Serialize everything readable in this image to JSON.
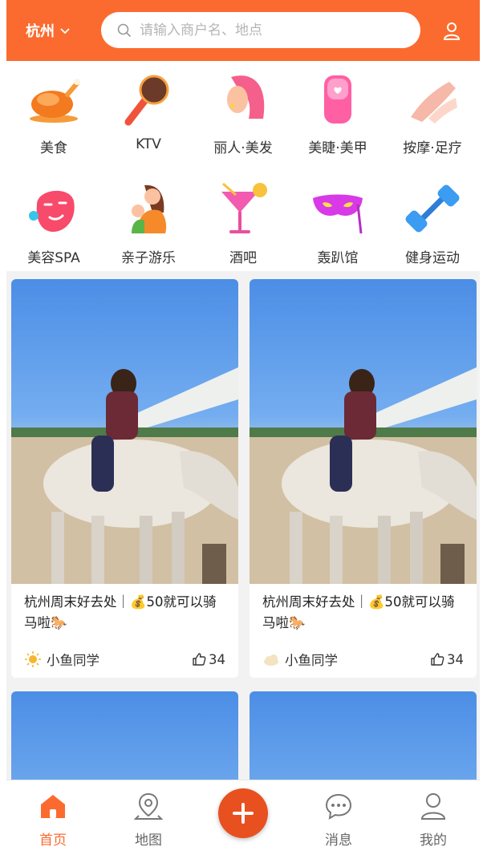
{
  "header": {
    "city": "杭州",
    "search_placeholder": "请输入商户名、地点",
    "accent": "#fb6b2f"
  },
  "categories": [
    {
      "label": "美食",
      "icon": "roast-chicken-icon"
    },
    {
      "label": "KTV",
      "icon": "microphone-icon"
    },
    {
      "label": "丽人·美发",
      "icon": "woman-hair-icon"
    },
    {
      "label": "美睫·美甲",
      "icon": "nail-icon"
    },
    {
      "label": "按摩·足疗",
      "icon": "massage-hand-icon"
    },
    {
      "label": "美容SPA",
      "icon": "face-mask-icon"
    },
    {
      "label": "亲子游乐",
      "icon": "mother-child-icon"
    },
    {
      "label": "酒吧",
      "icon": "cocktail-icon"
    },
    {
      "label": "轰趴馆",
      "icon": "party-mask-icon"
    },
    {
      "label": "健身运动",
      "icon": "dumbbell-icon"
    }
  ],
  "posts": [
    {
      "title": "杭州周末好去处｜💰50就可以骑马啦🐎",
      "author": "小鱼同学",
      "likes": "34",
      "avatar": "sun-avatar-icon"
    },
    {
      "title": "杭州周末好去处｜💰50就可以骑马啦🐎",
      "author": "小鱼同学",
      "likes": "34",
      "avatar": "cloud-avatar-icon"
    }
  ],
  "nav": {
    "home": "首页",
    "map": "地图",
    "messages": "消息",
    "mine": "我的"
  }
}
